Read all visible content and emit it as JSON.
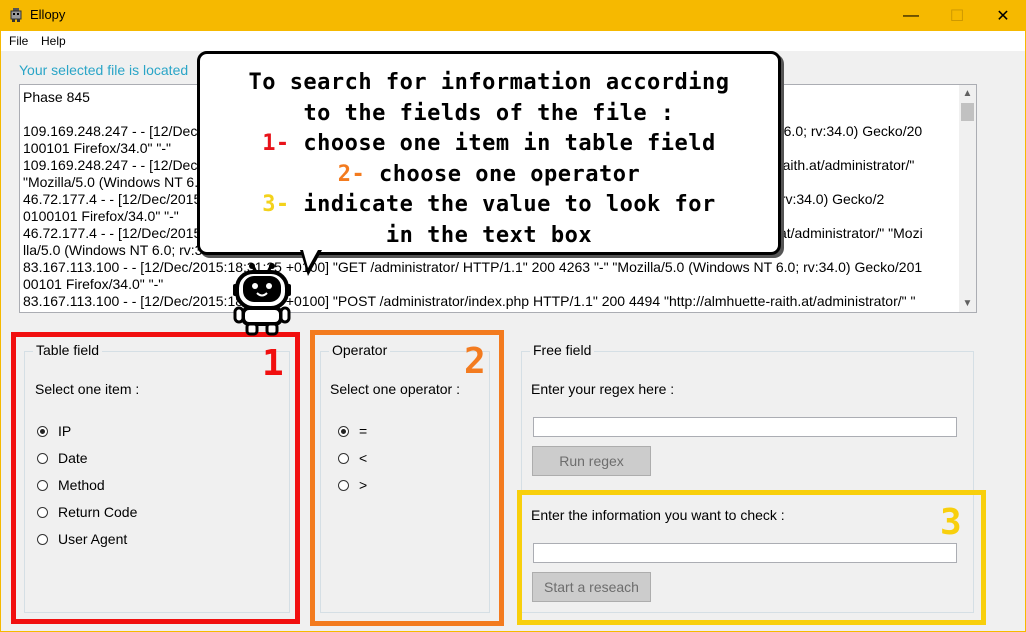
{
  "window": {
    "title": "Ellopy",
    "min_glyph": "—",
    "max_glyph": "☐",
    "close_glyph": "✕"
  },
  "menu": {
    "file": "File",
    "help": "Help"
  },
  "info_line": "Your selected file is located",
  "log": {
    "lines": [
      "Phase 845",
      "",
      "109.169.248.247 - - [12/Dec/2015:18:25:11 +0100] \"GET /administrator/ HTTP/1.1\" 200 4263 \"-\" \"Mozilla/5.0 (Windows NT 6.0; rv:34.0) Gecko/20",
      "100101 Firefox/34.0\" \"-\"",
      "109.169.248.247 - - [12/Dec/2015:18:25:11 +0100] \"POST /administrator/index.php HTTP/1.1\" 200 4494 \"http://almhuette-raith.at/administrator/\"",
      "\"Mozilla/5.0 (Windows NT 6.0; rv:34.0) Gecko/20100101 Firefox/34.0\" \"-\"",
      "46.72.177.4 - - [12/Dec/2015:18:31:08 +0100] \"GET /administrator/ HTTP/1.1\" 200 4263 \"-\" \"Mozilla/5.0 (Windows NT 6.0; rv:34.0) Gecko/2",
      "0100101 Firefox/34.0\" \"-\"",
      "46.72.177.4 - - [12/Dec/2015:18:31:08 +0100] \"POST /administrator/index.php HTTP/1.1\" 200 4494 \"http://almhuette-raith.at/administrator/\" \"Mozi",
      "lla/5.0 (Windows NT 6.0; rv:34.0) Gecko/20100101 Firefox/34.0\" \"-\"",
      "83.167.113.100 - - [12/Dec/2015:18:31:25 +0100] \"GET /administrator/ HTTP/1.1\" 200 4263 \"-\" \"Mozilla/5.0 (Windows NT 6.0; rv:34.0) Gecko/201",
      "00101 Firefox/34.0\" \"-\"",
      "83.167.113.100 - - [12/Dec/2015:18:31:25 +0100] \"POST /administrator/index.php HTTP/1.1\" 200 4494 \"http://almhuette-raith.at/administrator/\" \""
    ]
  },
  "callout": {
    "line1": "To search for information according",
    "line2": "to the fields of the file :",
    "step1_num": "1-",
    "step1_text": " choose one item in table field",
    "step2_num": "2-",
    "step2_text": " choose one operator",
    "step3_num": "3-",
    "step3_text": " indicate the value to look for",
    "line6": "in the text box"
  },
  "table_field": {
    "legend": "Table field",
    "prompt": "Select one item :",
    "options": [
      "IP",
      "Date",
      "Method",
      "Return Code",
      "User Agent"
    ],
    "selected": "IP",
    "badge": "1"
  },
  "operator": {
    "legend": "Operator",
    "prompt": "Select one operator :",
    "options": [
      "=",
      "<",
      ">"
    ],
    "selected": "=",
    "badge": "2"
  },
  "free_field": {
    "legend": "Free field",
    "regex_prompt": "Enter your regex here :",
    "regex_value": "",
    "run_button": "Run regex",
    "check_prompt": "Enter the information you want to check :",
    "check_value": "",
    "search_button": "Start a reseach",
    "badge": "3"
  },
  "colors": {
    "title_bar": "#f6b900",
    "info_text": "#2aa5c7",
    "highlight_1": "#f10f0f",
    "highlight_2": "#f37b1f",
    "highlight_3": "#f8cf0c"
  }
}
